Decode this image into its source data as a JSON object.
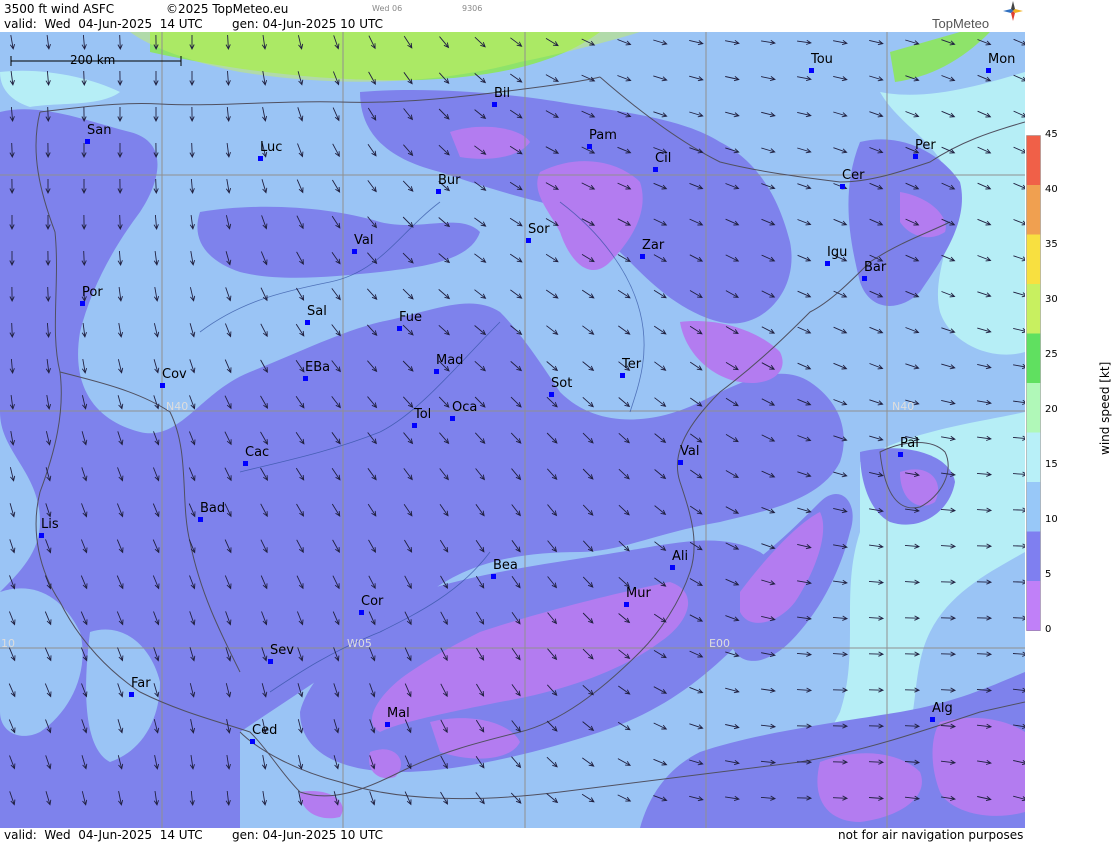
{
  "header": {
    "product": "3500 ft wind ASFC",
    "copyright": "©2025 TopMeteo.eu",
    "day_small": "Wed 06",
    "code_small": "9306",
    "valid": "valid:  Wed  04-Jun-2025  14 UTC",
    "gen": "gen: 04-Jun-2025 10 UTC"
  },
  "logo": {
    "text": "TopMeteo",
    "icon": "compass-star-icon"
  },
  "scale": {
    "label": "200 km"
  },
  "grid_labels": {
    "lat": "N40",
    "lat_east": "N40",
    "lon_w10": "10",
    "lon_w05": "W05",
    "lon_e00": "E00"
  },
  "cities": [
    {
      "key": "bil",
      "label": "Bil"
    },
    {
      "key": "tou",
      "label": "Tou"
    },
    {
      "key": "mon",
      "label": "Mon"
    },
    {
      "key": "san",
      "label": "San"
    },
    {
      "key": "luc",
      "label": "Luc"
    },
    {
      "key": "pam",
      "label": "Pam"
    },
    {
      "key": "cil",
      "label": "Cil"
    },
    {
      "key": "per",
      "label": "Per"
    },
    {
      "key": "bur",
      "label": "Bur"
    },
    {
      "key": "cer",
      "label": "Cer"
    },
    {
      "key": "val1",
      "label": "Val"
    },
    {
      "key": "sor",
      "label": "Sor"
    },
    {
      "key": "zar",
      "label": "Zar"
    },
    {
      "key": "igu",
      "label": "Igu"
    },
    {
      "key": "bar",
      "label": "Bar"
    },
    {
      "key": "por",
      "label": "Por"
    },
    {
      "key": "sal",
      "label": "Sal"
    },
    {
      "key": "fue",
      "label": "Fue"
    },
    {
      "key": "mad",
      "label": "Mad"
    },
    {
      "key": "cov",
      "label": "Cov"
    },
    {
      "key": "eba",
      "label": "EBa"
    },
    {
      "key": "ter",
      "label": "Ter"
    },
    {
      "key": "sot",
      "label": "Sot"
    },
    {
      "key": "tol",
      "label": "Tol"
    },
    {
      "key": "oca",
      "label": "Oca"
    },
    {
      "key": "pal",
      "label": "Pal"
    },
    {
      "key": "cac",
      "label": "Cac"
    },
    {
      "key": "val2",
      "label": "Val"
    },
    {
      "key": "bad",
      "label": "Bad"
    },
    {
      "key": "lis",
      "label": "Lis"
    },
    {
      "key": "ali",
      "label": "Ali"
    },
    {
      "key": "bea",
      "label": "Bea"
    },
    {
      "key": "mur",
      "label": "Mur"
    },
    {
      "key": "cor",
      "label": "Cor"
    },
    {
      "key": "sev",
      "label": "Sev"
    },
    {
      "key": "far",
      "label": "Far"
    },
    {
      "key": "alg",
      "label": "Alg"
    },
    {
      "key": "mal",
      "label": "Mal"
    },
    {
      "key": "ced",
      "label": "Ced"
    }
  ],
  "legend": {
    "title": "wind  speed  [kt]",
    "ticks": [
      "45",
      "40",
      "35",
      "30",
      "25",
      "20",
      "15",
      "10",
      "5",
      "0"
    ],
    "colors": [
      "#f06048",
      "#f0a050",
      "#f8e040",
      "#c8f060",
      "#60e060",
      "#b0f8b8",
      "#b8f0f8",
      "#98c8f8",
      "#7f7ff0",
      "#c080f8"
    ]
  },
  "colors": {
    "band_light_blue": "#9ac4f5",
    "band_purple": "#7e82ec",
    "band_violet": "#b37cf0",
    "band_cyan": "#b6eef6",
    "band_green": "#8ee36a",
    "grid": "#909090",
    "border": "#505060",
    "arrow": "#202040",
    "city_dot": "#0000ff"
  },
  "footer": {
    "valid": "valid:  Wed  04-Jun-2025  14 UTC",
    "gen": "gen: 04-Jun-2025 10 UTC",
    "disclaimer": "not for air navigation purposes"
  }
}
